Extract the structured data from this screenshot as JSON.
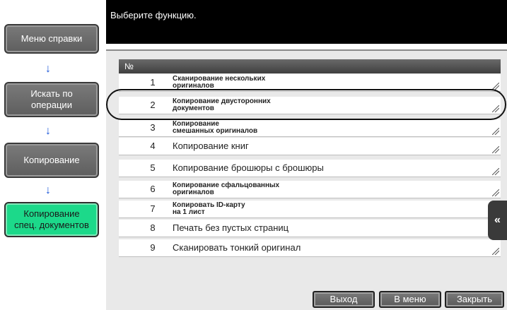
{
  "header": {
    "prompt": "Выберите функцию."
  },
  "nav": {
    "items": [
      {
        "label": "Меню справки"
      },
      {
        "label": "Искать по\nоперации"
      },
      {
        "label": "Копирование"
      },
      {
        "label": "Копирование\nспец. документов"
      }
    ],
    "arrow_glyph": "↓"
  },
  "table": {
    "header": "№",
    "rows": [
      {
        "num": "1",
        "label": "Сканирование нескольких\nоригиналов"
      },
      {
        "num": "2",
        "label": "Копирование двусторонних\nдокументов"
      },
      {
        "num": "3",
        "label": "Копирование\nсмешанных оригиналов"
      },
      {
        "num": "4",
        "label": "Копирование книг"
      },
      {
        "num": "5",
        "label": "Копирование брошюры с брошюры"
      },
      {
        "num": "6",
        "label": "Копирование сфальцованных\nоригиналов"
      },
      {
        "num": "7",
        "label": "Копировать ID-карту\nна 1 лист"
      },
      {
        "num": "8",
        "label": "Печать без пустых страниц"
      },
      {
        "num": "9",
        "label": "Сканировать тонкий оригинал"
      }
    ]
  },
  "side_tab": {
    "glyph": "«"
  },
  "footer": {
    "exit": "Выход",
    "to_menu": "В меню",
    "close": "Закрыть"
  }
}
